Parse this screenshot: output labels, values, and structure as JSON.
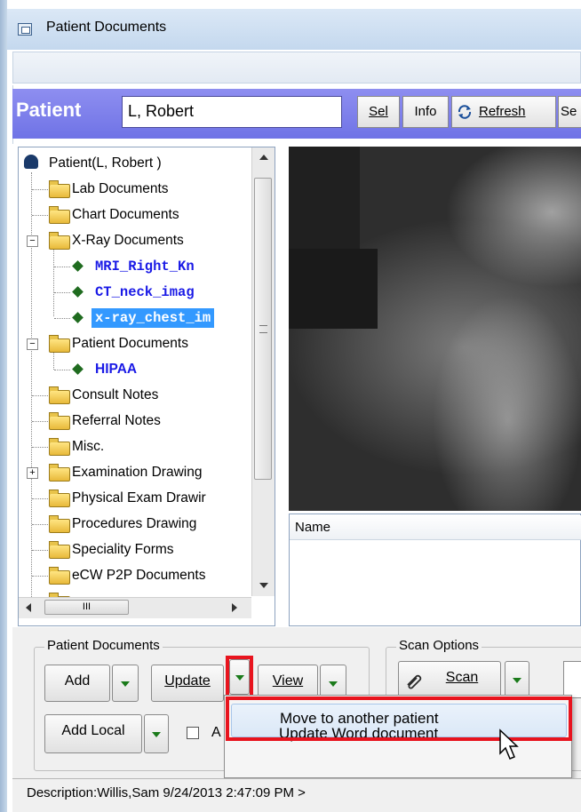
{
  "window": {
    "title": "Patient Documents"
  },
  "patient_bar": {
    "label": "Patient",
    "patient_name": "L, Robert"
  },
  "toolbar": {
    "sel_label": "Sel",
    "info_label": "Info",
    "refresh_label": "Refresh",
    "truncated_label": "Se"
  },
  "tree": {
    "root": "Patient(L, Robert )",
    "items": [
      {
        "label": "Lab Documents",
        "type": "folder"
      },
      {
        "label": "Chart Documents",
        "type": "folder"
      },
      {
        "label": "X-Ray Documents",
        "type": "folder",
        "expanded": true
      },
      {
        "label": "MRI_Right_Kn",
        "type": "document"
      },
      {
        "label": "CT_neck_imag",
        "type": "document"
      },
      {
        "label": "x-ray_chest_im",
        "type": "document",
        "selected": true
      },
      {
        "label": "Patient Documents",
        "type": "folder",
        "expanded": true
      },
      {
        "label": "HIPAA",
        "type": "document"
      },
      {
        "label": "Consult Notes",
        "type": "folder"
      },
      {
        "label": "Referral Notes",
        "type": "folder"
      },
      {
        "label": "Misc.",
        "type": "folder"
      },
      {
        "label": "Examination Drawing",
        "type": "folder",
        "collapsed": true
      },
      {
        "label": "Physical Exam Drawir",
        "type": "folder"
      },
      {
        "label": "Procedures Drawing",
        "type": "folder"
      },
      {
        "label": "Speciality Forms",
        "type": "folder"
      },
      {
        "label": "eCW P2P Documents",
        "type": "folder"
      }
    ],
    "hscroll_glyph": "III"
  },
  "list": {
    "column_name": "Name"
  },
  "patient_documents_group": {
    "title": "Patient Documents",
    "add_label": "Add",
    "update_label": "Update",
    "view_label": "View",
    "add_local_label": "Add Local",
    "checkbox_label": "A"
  },
  "scan_options_group": {
    "title": "Scan Options",
    "scan_label": "Scan"
  },
  "context_menu": {
    "items": [
      "Move to another patient",
      "Update Word document"
    ],
    "highlighted": "Move to another patient"
  },
  "status": {
    "description": "Description:Willis,Sam  9/24/2013 2:47:09 PM >"
  },
  "colors": {
    "highlight_red": "#e8141e",
    "patient_bar": "#7d80ea",
    "link_blue": "#1a1ae6",
    "selection": "#3399ff"
  }
}
